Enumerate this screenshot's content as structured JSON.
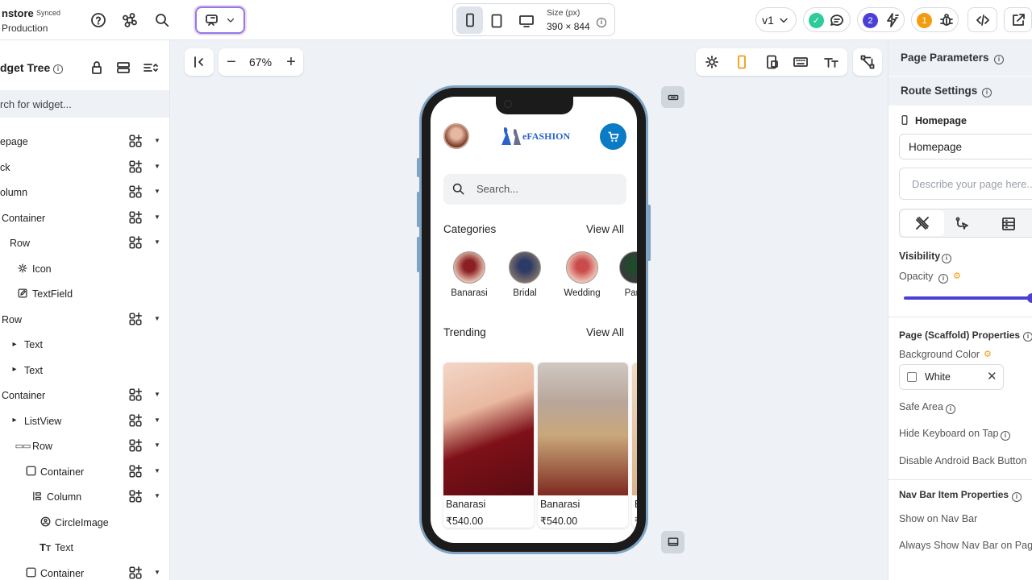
{
  "topbar": {
    "project_name": "nstore",
    "sync_status": "Synced",
    "branch": "Production",
    "size_label": "Size (px)",
    "size_value": "390 × 844",
    "version": "v1",
    "badge_count_1": "2",
    "badge_count_2": "1"
  },
  "canvas_toolbar": {
    "zoom": "67%"
  },
  "widget_tree": {
    "title": "dget Tree",
    "search_placeholder": "rch for widget...",
    "items": [
      {
        "label": "epage"
      },
      {
        "label": "ck"
      },
      {
        "label": "olumn"
      },
      {
        "label": "Container"
      },
      {
        "label": "Row"
      },
      {
        "label": "Icon"
      },
      {
        "label": "TextField"
      },
      {
        "label": "Row"
      },
      {
        "label": "Text"
      },
      {
        "label": "Text"
      },
      {
        "label": "Container"
      },
      {
        "label": "ListView"
      },
      {
        "label": "Row"
      },
      {
        "label": "Container"
      },
      {
        "label": "Column"
      },
      {
        "label": "CircleImage"
      },
      {
        "label": "Text"
      },
      {
        "label": "Container"
      }
    ]
  },
  "phone": {
    "logo_text": "eFASHION",
    "search_placeholder": "Search...",
    "categories_title": "Categories",
    "categories_view_all": "View All",
    "categories": [
      "Banarasi",
      "Bridal",
      "Wedding",
      "Party"
    ],
    "trending_title": "Trending",
    "trending_view_all": "View All",
    "products": [
      {
        "name": "Banarasi",
        "price": "₹540.00"
      },
      {
        "name": "Banarasi",
        "price": "₹540.00"
      },
      {
        "name": "B",
        "price": "₹"
      }
    ]
  },
  "right_panel": {
    "page_parameters": "Page Parameters",
    "route_settings": "Route Settings",
    "page_title": "Homepage",
    "page_name_value": "Homepage",
    "description_placeholder": "Describe your page here...",
    "visibility": "Visibility",
    "opacity": "Opacity",
    "scaffold_title": "Page (Scaffold) Properties",
    "background_color_label": "Background Color",
    "background_color_value": "White",
    "safe_area": "Safe Area",
    "hide_keyboard": "Hide Keyboard on Tap",
    "disable_back": "Disable Android Back Button",
    "nav_bar_title": "Nav Bar Item Properties",
    "show_on_nav": "Show on Nav Bar",
    "always_show_nav": "Always Show Nav Bar on Page"
  },
  "colors": {
    "accent": "#4b3fd6",
    "cart": "#0a7bc4",
    "orange": "#f39c12",
    "green": "#2ecc9a"
  }
}
